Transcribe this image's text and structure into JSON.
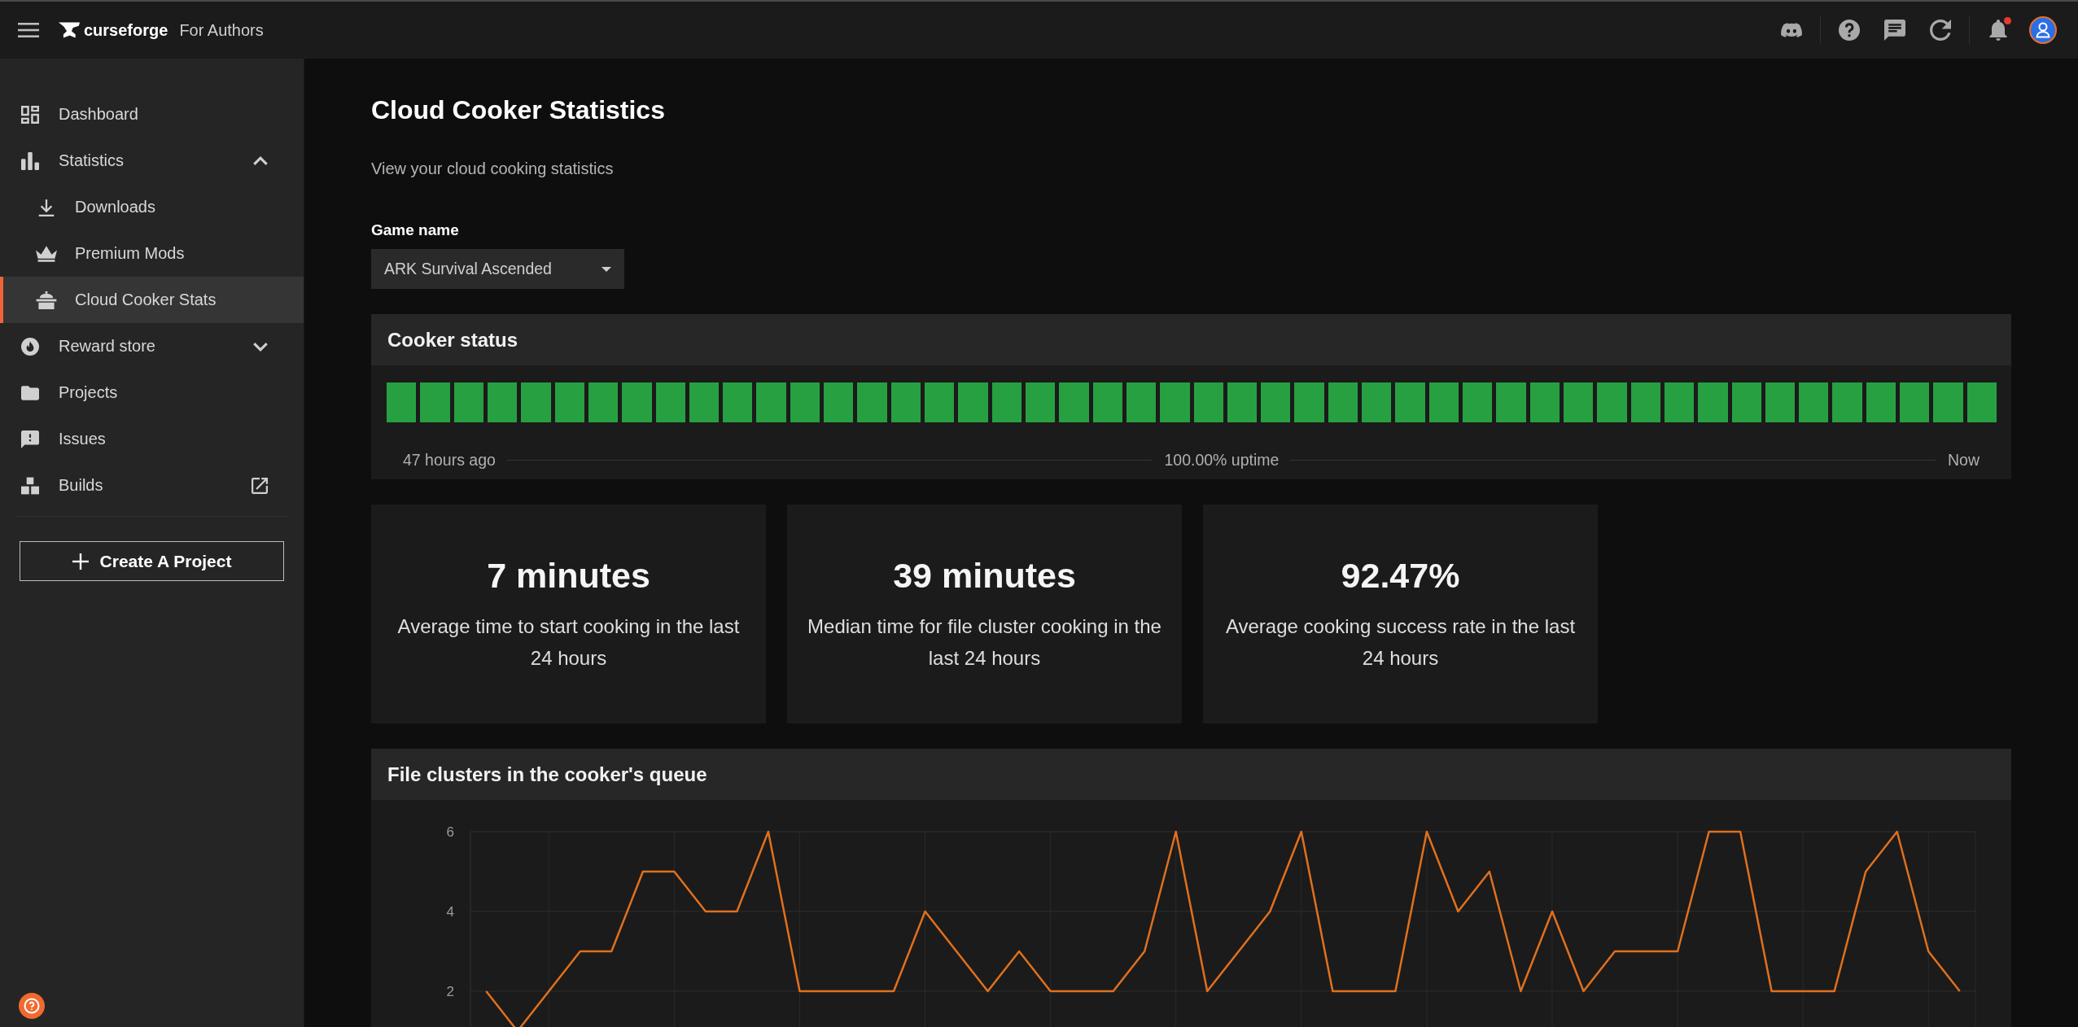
{
  "top_bar": {
    "brand": "curseforge",
    "section": "For Authors",
    "unread_notifications": true
  },
  "sidebar": {
    "items": [
      {
        "label": "Dashboard",
        "kind": "link",
        "selected": false
      },
      {
        "label": "Statistics",
        "kind": "group",
        "expanded": true,
        "selected": false,
        "children": [
          {
            "label": "Downloads",
            "selected": false
          },
          {
            "label": "Premium Mods",
            "selected": false
          },
          {
            "label": "Cloud Cooker Stats",
            "selected": true
          }
        ]
      },
      {
        "label": "Reward store",
        "kind": "group",
        "expanded": false,
        "selected": false
      },
      {
        "label": "Projects",
        "kind": "link",
        "selected": false
      },
      {
        "label": "Issues",
        "kind": "link",
        "selected": false
      },
      {
        "label": "Builds",
        "kind": "external",
        "selected": false
      }
    ],
    "create_button": "Create A Project"
  },
  "page": {
    "title": "Cloud Cooker Statistics",
    "subtitle": "View your cloud cooking statistics"
  },
  "game_select": {
    "label": "Game name",
    "value": "ARK Survival Ascended"
  },
  "cooker_status": {
    "title": "Cooker status",
    "hours": [
      {
        "up": true
      },
      {
        "up": true
      },
      {
        "up": true
      },
      {
        "up": true
      },
      {
        "up": true
      },
      {
        "up": true
      },
      {
        "up": true
      },
      {
        "up": true
      },
      {
        "up": true
      },
      {
        "up": true
      },
      {
        "up": true
      },
      {
        "up": true
      },
      {
        "up": true
      },
      {
        "up": true
      },
      {
        "up": true
      },
      {
        "up": true
      },
      {
        "up": true
      },
      {
        "up": true
      },
      {
        "up": true
      },
      {
        "up": true
      },
      {
        "up": true
      },
      {
        "up": true
      },
      {
        "up": true
      },
      {
        "up": true
      },
      {
        "up": true
      },
      {
        "up": true
      },
      {
        "up": true
      },
      {
        "up": true
      },
      {
        "up": true
      },
      {
        "up": true
      },
      {
        "up": true
      },
      {
        "up": true
      },
      {
        "up": true
      },
      {
        "up": true
      },
      {
        "up": true
      },
      {
        "up": true
      },
      {
        "up": true
      },
      {
        "up": true
      },
      {
        "up": true
      },
      {
        "up": true
      },
      {
        "up": true
      },
      {
        "up": true
      },
      {
        "up": true
      },
      {
        "up": true
      },
      {
        "up": true
      },
      {
        "up": true
      },
      {
        "up": true
      },
      {
        "up": true
      }
    ],
    "start_label": "47 hours ago",
    "uptime": "100.00% uptime",
    "end_label": "Now"
  },
  "stats": [
    {
      "value": "7 minutes",
      "caption": "Average time to start cooking in the last 24 hours"
    },
    {
      "value": "39 minutes",
      "caption": "Median time for file cluster cooking in the last 24 hours"
    },
    {
      "value": "92.47%",
      "caption": "Average cooking success rate in the last 24 hours"
    }
  ],
  "queue_chart": {
    "title": "File clusters in the cooker's queue",
    "chart_data": {
      "type": "line",
      "grid": true,
      "categories": [
        null,
        null,
        null,
        null,
        null,
        null,
        null,
        null,
        null,
        null,
        null,
        null,
        null,
        null,
        null,
        null,
        null,
        null,
        null,
        null,
        null,
        null,
        null,
        null,
        null,
        null,
        null,
        null,
        null,
        null,
        null,
        null,
        null,
        null,
        null,
        null,
        null,
        null,
        null,
        null,
        null,
        null,
        null,
        null,
        null,
        null,
        null,
        null
      ],
      "ylim": [
        0,
        6
      ],
      "yticks": [
        2,
        4,
        6
      ],
      "values": [
        2,
        1,
        2,
        3,
        3,
        5,
        5,
        4,
        4,
        6,
        2,
        2,
        2,
        2,
        4,
        3,
        2,
        3,
        2,
        2,
        2,
        3,
        6,
        2,
        3,
        4,
        6,
        2,
        2,
        2,
        6,
        4,
        5,
        2,
        4,
        2,
        3,
        3,
        3,
        6,
        6,
        2,
        2,
        2,
        5,
        6,
        3,
        2
      ]
    }
  }
}
